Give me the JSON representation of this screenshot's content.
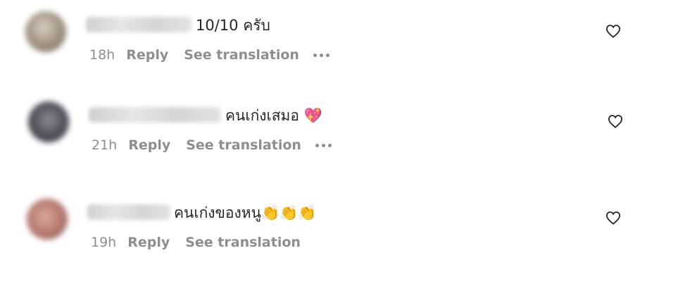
{
  "comments": [
    {
      "text": "10/10 ครับ",
      "time": "18h",
      "reply_label": "Reply",
      "translation_label": "See translation",
      "has_more": true
    },
    {
      "text": "คนเก่งเสมอ",
      "emoji": "💖",
      "time": "21h",
      "reply_label": "Reply",
      "translation_label": "See translation",
      "has_more": true
    },
    {
      "text": "คนเก่งของหนู",
      "emoji": "👏👏👏",
      "time": "19h",
      "reply_label": "Reply",
      "translation_label": "See translation",
      "has_more": false
    }
  ],
  "icons": {
    "like": "heart-outline-icon",
    "more": "more-options-icon"
  },
  "colors": {
    "text": "#262626",
    "secondary": "#8e8e8e",
    "background": "#ffffff"
  }
}
